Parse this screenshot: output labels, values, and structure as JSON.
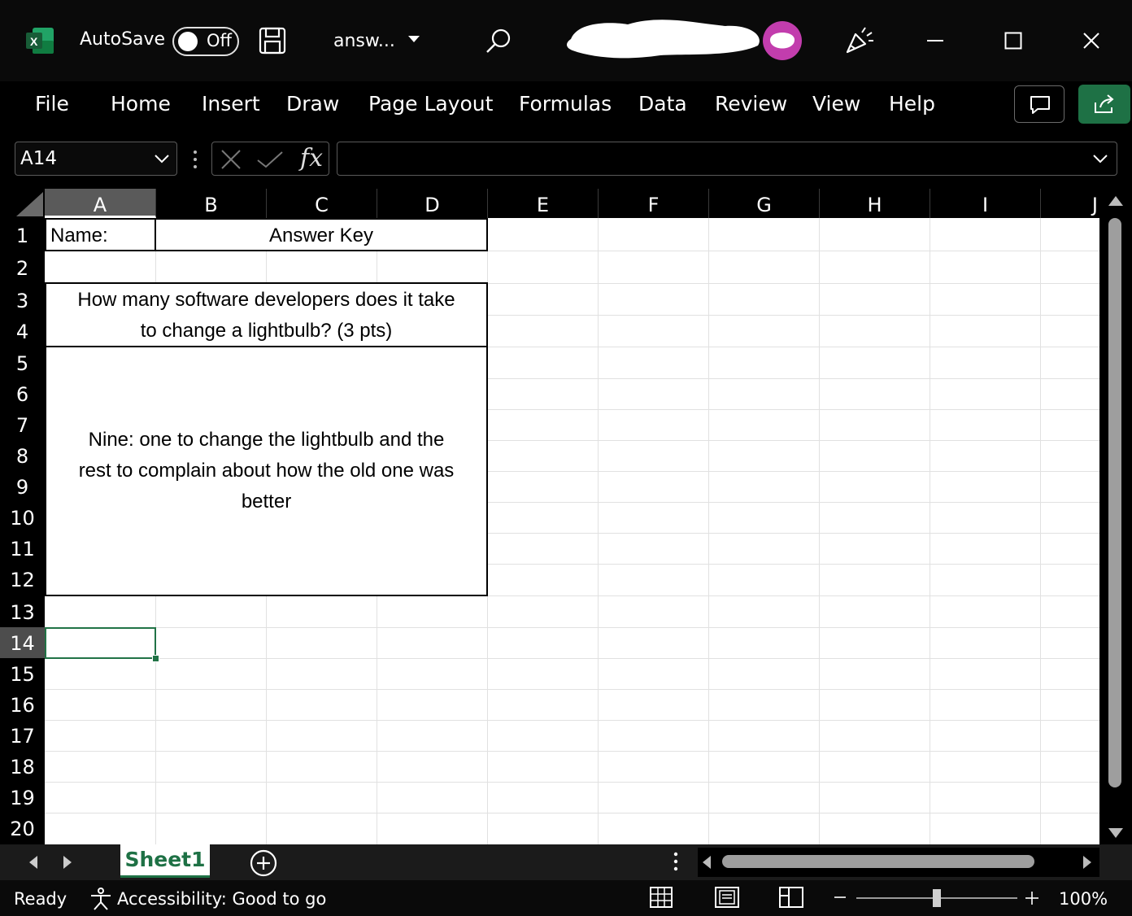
{
  "title_bar": {
    "autosave_label": "AutoSave",
    "autosave_state": "Off",
    "file_name": "answ...",
    "icons": [
      "excel-logo-icon",
      "save-icon",
      "dropdown-icon",
      "search-icon",
      "account-avatar-icon",
      "celebrate-icon",
      "minimize-icon",
      "maximize-icon",
      "close-icon"
    ]
  },
  "ribbon": {
    "tabs": [
      "File",
      "Home",
      "Insert",
      "Draw",
      "Page Layout",
      "Formulas",
      "Data",
      "Review",
      "View",
      "Help"
    ]
  },
  "formula_bar": {
    "name_box": "A14",
    "fx_label": "fx",
    "formula_value": ""
  },
  "grid": {
    "columns": [
      "A",
      "B",
      "C",
      "D",
      "E",
      "F",
      "G",
      "H",
      "I",
      "J"
    ],
    "selected_column": "A",
    "rows": [
      "1",
      "2",
      "3",
      "4",
      "5",
      "6",
      "7",
      "8",
      "9",
      "10",
      "11",
      "12",
      "13",
      "14",
      "15",
      "16",
      "17",
      "18",
      "19",
      "20"
    ],
    "selected_row": "14",
    "selected_cell": "A14",
    "cells": {
      "A1": "Name:",
      "B1": "Answer Key",
      "A3_line1": "How many software developers does it take",
      "A3_line2": "to change a lightbulb? (3 pts)",
      "A5_line1": "Nine: one to change the lightbulb and the",
      "A5_line2": "rest to complain about how the old one was",
      "A5_line3": "better"
    }
  },
  "sheet_tabs": {
    "active": "Sheet1"
  },
  "status_bar": {
    "ready": "Ready",
    "accessibility": "Accessibility: Good to go",
    "zoom": "100%",
    "zoom_level": 1.0
  },
  "colors": {
    "excel_green": "#1e7145",
    "selection_green": "#217346",
    "avatar_pink": "#c23dad"
  }
}
